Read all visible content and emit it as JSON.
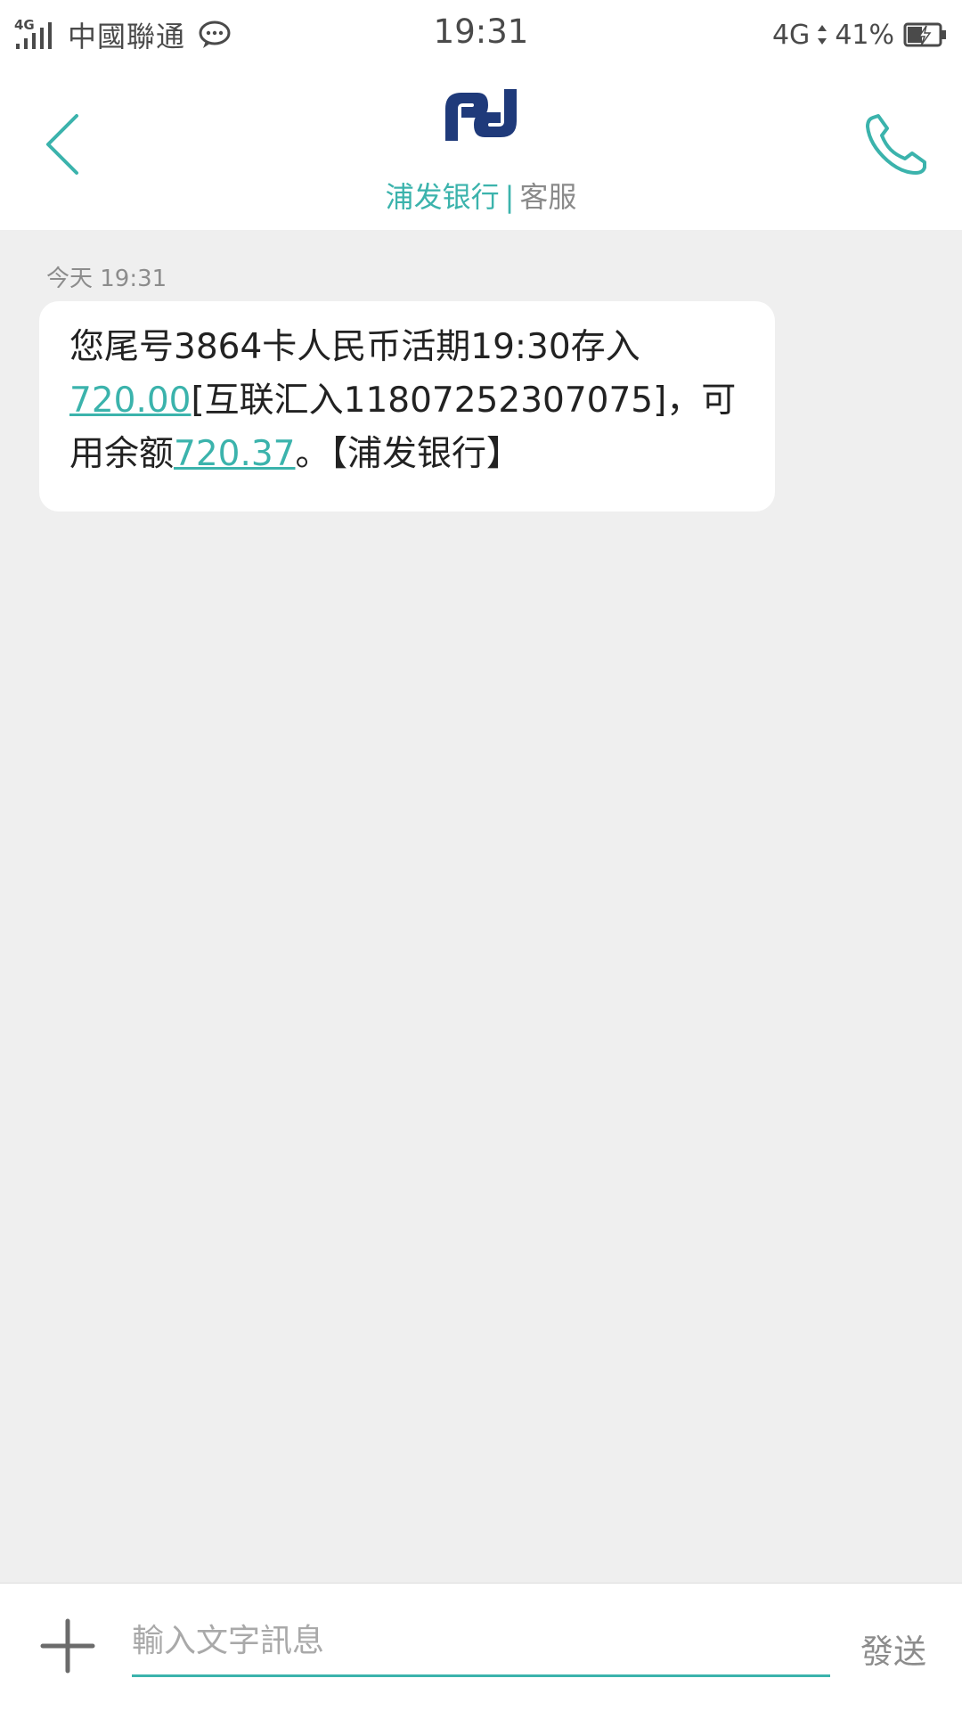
{
  "status_bar": {
    "network_small": "4G",
    "carrier": "中國聯通",
    "time": "19:31",
    "network_type": "4G",
    "battery_percent": "41%",
    "icons": [
      "signal-icon",
      "message-notification-icon",
      "data-arrows-icon",
      "battery-charging-icon"
    ]
  },
  "header": {
    "contact_name": "浦发银行",
    "separator": "|",
    "contact_tag": "客服",
    "logo": "spdb-logo",
    "back_icon": "chevron-left-icon",
    "call_icon": "phone-icon"
  },
  "conversation": {
    "messages": [
      {
        "timestamp": "今天  19:31",
        "text_part1": "您尾号3864卡人民币活期19:30存入",
        "amount_link": "720.00",
        "text_part2": "[互联汇入11807252307075]，可用余额",
        "balance_link": "720.37",
        "text_part3": "。【浦发银行】"
      }
    ]
  },
  "composer": {
    "placeholder": "輸入文字訊息",
    "value": "",
    "send_label": "發送",
    "add_icon": "plus-icon"
  },
  "colors": {
    "accent": "#3bb3ac",
    "logo_blue": "#1f3a7a",
    "background": "#efefef",
    "bubble": "#ffffff"
  }
}
